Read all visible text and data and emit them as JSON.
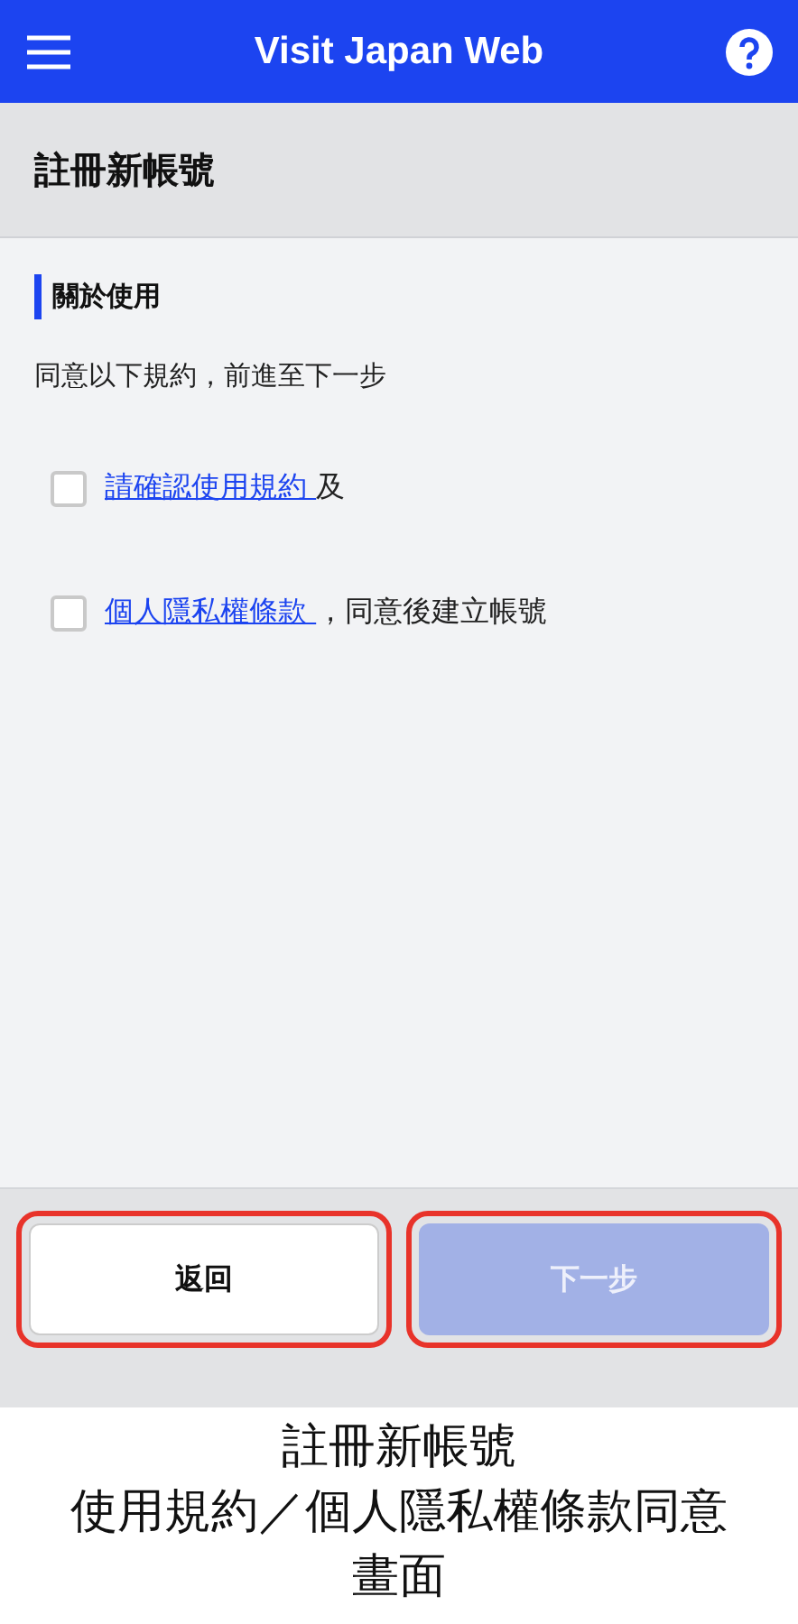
{
  "header": {
    "title": "Visit Japan Web"
  },
  "page_title": "註冊新帳號",
  "section": {
    "heading": "關於使用",
    "intro": "同意以下規約，前進至下一步"
  },
  "agreements": [
    {
      "link": "請確認使用規約 ",
      "suffix": "及",
      "checked": false
    },
    {
      "link": "個人隱私權條款 ",
      "suffix": "，同意後建立帳號",
      "checked": false
    }
  ],
  "buttons": [
    {
      "label": "返回",
      "kind": "secondary",
      "disabled": false,
      "highlighted": true
    },
    {
      "label": "下一步",
      "kind": "primary",
      "disabled": true,
      "highlighted": true
    }
  ],
  "caption": [
    "註冊新帳號",
    "使用規約／個人隱私權條款同意",
    "畫面"
  ]
}
